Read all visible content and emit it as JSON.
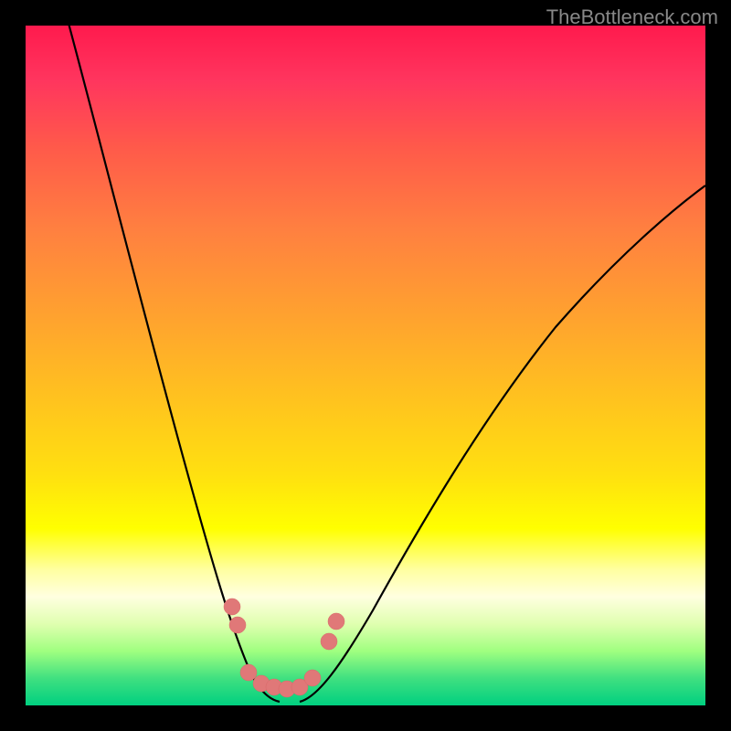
{
  "watermark": "TheBottleneck.com",
  "chart_data": {
    "type": "line",
    "title": "",
    "xlabel": "",
    "ylabel": "",
    "xlim": [
      0,
      100
    ],
    "ylim": [
      0,
      100
    ],
    "gradient_background": {
      "top": "#ff1a4d",
      "middle": "#ffff00",
      "bottom": "#00d080",
      "meaning": "red-high-bottleneck, green-low-bottleneck"
    },
    "series": [
      {
        "name": "left-curve",
        "description": "descending curve from top-left to trough",
        "x": [
          6,
          10,
          14,
          18,
          22,
          26,
          28,
          30,
          32,
          34,
          36
        ],
        "y": [
          100,
          84,
          66,
          48,
          32,
          18,
          12,
          8,
          6,
          4,
          3
        ]
      },
      {
        "name": "right-curve",
        "description": "ascending curve from trough to top-right",
        "x": [
          42,
          46,
          50,
          56,
          62,
          70,
          78,
          86,
          94,
          100
        ],
        "y": [
          3,
          6,
          10,
          16,
          24,
          34,
          44,
          54,
          62,
          68
        ]
      }
    ],
    "markers": {
      "name": "highlighted-points",
      "color": "#e07878",
      "description": "salmon data-point markers near trough",
      "points": [
        {
          "x": 28.5,
          "y": 14
        },
        {
          "x": 29.5,
          "y": 11
        },
        {
          "x": 31,
          "y": 4.5
        },
        {
          "x": 33,
          "y": 3.2
        },
        {
          "x": 35,
          "y": 2.8
        },
        {
          "x": 37,
          "y": 2.6
        },
        {
          "x": 39,
          "y": 2.8
        },
        {
          "x": 41,
          "y": 4
        },
        {
          "x": 43,
          "y": 9
        },
        {
          "x": 44,
          "y": 12
        }
      ]
    },
    "optimal_zone": {
      "y_range": [
        0,
        5
      ],
      "color": "#00d080",
      "description": "green band indicating optimal/no-bottleneck region"
    }
  }
}
